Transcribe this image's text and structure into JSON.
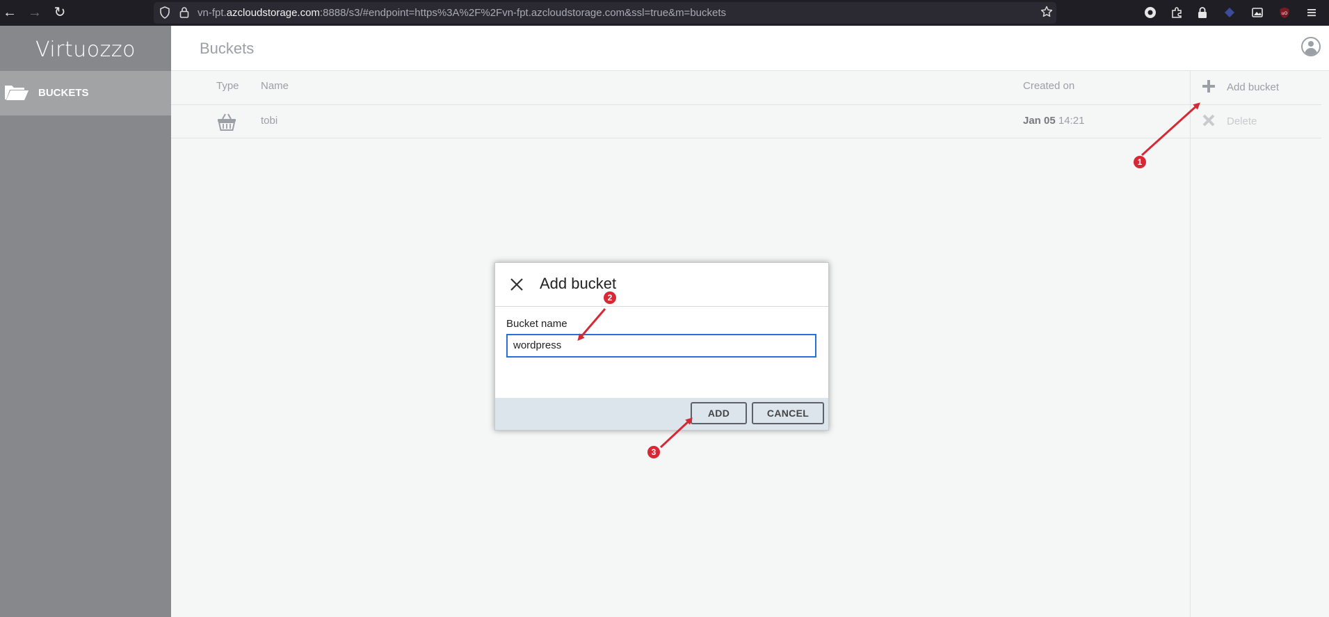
{
  "browser": {
    "url_prefix": "vn-fpt.",
    "url_domain": "azcloudstorage.com",
    "url_rest": ":8888/s3/#endpoint=https%3A%2F%2Fvn-fpt.azcloudstorage.com&ssl=true&m=buckets",
    "icons": [
      "back-icon",
      "forward-icon",
      "reload-icon",
      "shield-icon",
      "lock-icon",
      "star-icon",
      "extension-icons",
      "menu-icon"
    ]
  },
  "app": {
    "logo": "Virtuozzo",
    "sidebar": {
      "items": [
        {
          "label": "BUCKETS",
          "icon": "folder-open-icon"
        }
      ]
    },
    "header": {
      "title": "Buckets"
    }
  },
  "table": {
    "columns": [
      "Type",
      "Name",
      "Created on"
    ],
    "rows": [
      {
        "type_icon": "basket-icon",
        "name": "tobi",
        "created_date": "Jan 05",
        "created_time": "14:21"
      }
    ]
  },
  "actions": [
    {
      "label": "Add bucket",
      "icon": "plus-icon",
      "color": "#9aa0a6"
    },
    {
      "label": "Delete",
      "icon": "x-icon",
      "color": "#c8cacc"
    }
  ],
  "dialog": {
    "title": "Add bucket",
    "field_label": "Bucket name",
    "field_value": "wordpress",
    "add_label": "ADD",
    "cancel_label": "CANCEL"
  },
  "annotations": {
    "markers": [
      "1",
      "2",
      "3"
    ],
    "color": "#d72836"
  }
}
